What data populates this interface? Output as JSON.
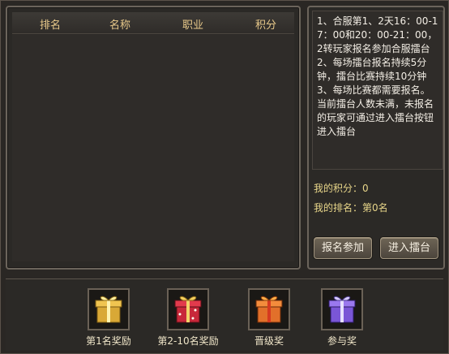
{
  "rank_table": {
    "columns": [
      "排名",
      "名称",
      "职业",
      "积分"
    ]
  },
  "rules": {
    "lines": [
      "1、合服第1、2天16：00-17：00和20：00-21：00，2转玩家报名参加合服擂台",
      "2、每场擂台报名持续5分钟，擂台比赛持续10分钟",
      "3、每场比赛都需要报名。当前擂台人数未满，未报名的玩家可通过进入擂台按钮进入擂台"
    ]
  },
  "stats": {
    "my_score_label": "我的积分：0",
    "my_rank_label": "我的排名：第0名"
  },
  "buttons": {
    "signup": "报名参加",
    "enter": "进入擂台"
  },
  "rewards": [
    {
      "label": "第1名奖励",
      "icon": "gold-gift-icon",
      "color": "#d9a836"
    },
    {
      "label": "第2-10名奖励",
      "icon": "red-gift-icon",
      "color": "#c8283a"
    },
    {
      "label": "晋级奖",
      "icon": "orange-gift-icon",
      "color": "#e2702a"
    },
    {
      "label": "参与奖",
      "icon": "purple-gift-icon",
      "color": "#7a56d6"
    }
  ]
}
